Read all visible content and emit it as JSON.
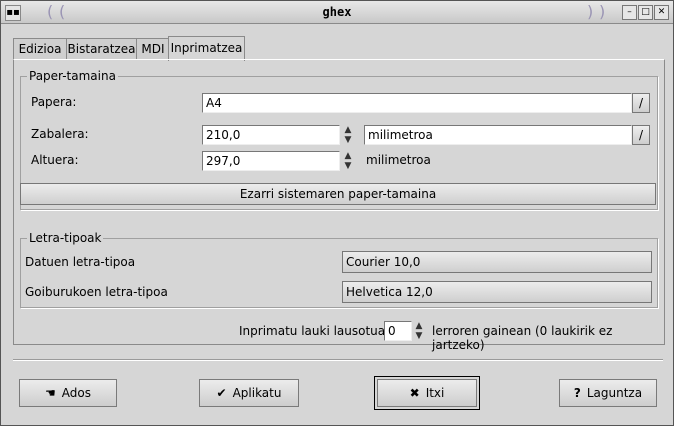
{
  "window": {
    "title": "ghex"
  },
  "tabs": [
    "Edizioa",
    "Bistaratzea",
    "MDI",
    "Inprimatzea"
  ],
  "paper": {
    "legend": "Paper-tamaina",
    "paper_label": "Papera:",
    "paper_value": "A4",
    "width_label": "Zabalera:",
    "width_value": "210,0",
    "unit_value": "milimetroa",
    "height_label": "Altuera:",
    "height_value": "297,0",
    "height_unit": "milimetroa",
    "system_button": "Ezarri sistemaren paper-tamaina"
  },
  "fonts": {
    "legend": "Letra-tipoak",
    "data_label": "Datuen letra-tipoa",
    "data_value": "Courier 10,0",
    "header_label": "Goiburukoen letra-tipoa",
    "header_value": "Helvetica 12,0"
  },
  "shaded": {
    "label": "Inprimatu lauki lausotua",
    "value": "0",
    "suffix": "lerroren gainean (0 laukirik ez jartzeko)"
  },
  "buttons": {
    "ok": "Ados",
    "apply": "Aplikatu",
    "close": "Itxi",
    "help": "Laguntza"
  }
}
